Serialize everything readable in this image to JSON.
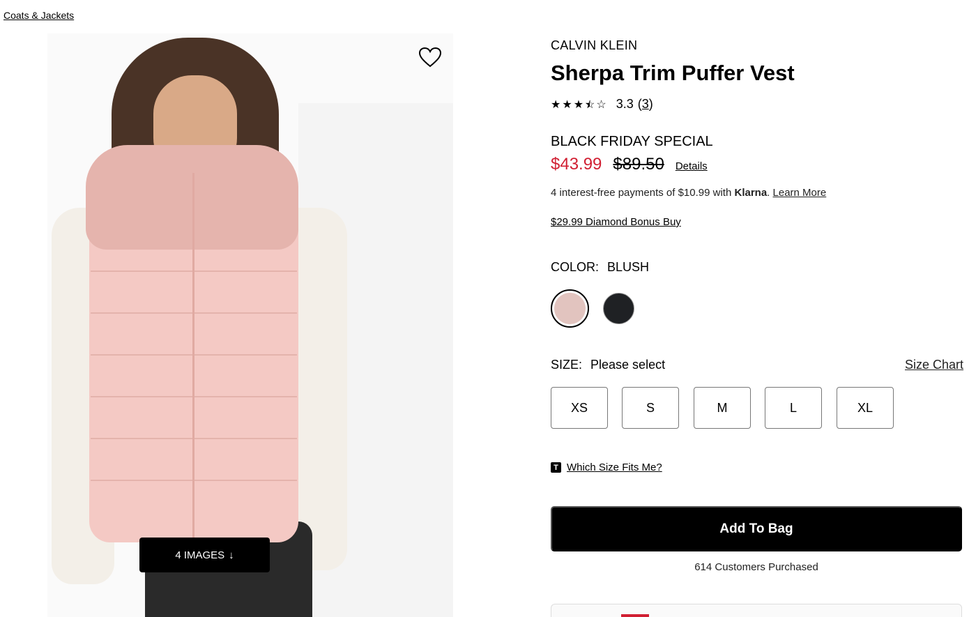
{
  "breadcrumb": "Coats & Jackets",
  "gallery": {
    "images_button": "4 IMAGES",
    "arrow": "↓"
  },
  "product": {
    "brand": "CALVIN KLEIN",
    "title": "Sherpa Trim Puffer Vest",
    "rating": {
      "value": "3.3",
      "count_open": "(",
      "count": "3",
      "count_close": ")",
      "stars_filled": 3.5,
      "stars_total": 5
    },
    "promo_label": "BLACK FRIDAY SPECIAL",
    "sale_price": "$43.99",
    "original_price": "$89.50",
    "details_link": "Details",
    "klarna": {
      "prefix": "4 interest-free payments of $10.99 with ",
      "brand": "Klarna",
      "suffix": ". ",
      "link": "Learn More"
    },
    "bonus_buy": "$29.99 Diamond Bonus Buy"
  },
  "color": {
    "label": "COLOR:",
    "selected": "BLUSH",
    "swatches": [
      {
        "name": "Blush",
        "hex": "#e2c4bf"
      },
      {
        "name": "Black",
        "hex": "#1f2124"
      }
    ]
  },
  "size": {
    "label": "SIZE:",
    "selected": "Please select",
    "chart_link": "Size Chart",
    "options": [
      "XS",
      "S",
      "M",
      "L",
      "XL"
    ]
  },
  "fit": {
    "icon_letter": "T",
    "link": "Which Size Fits Me?"
  },
  "cta": {
    "add_to_bag": "Add To Bag",
    "purchased": "614 Customers Purchased"
  },
  "colors": {
    "sale": "#d12033",
    "cta_bg": "#000000"
  }
}
